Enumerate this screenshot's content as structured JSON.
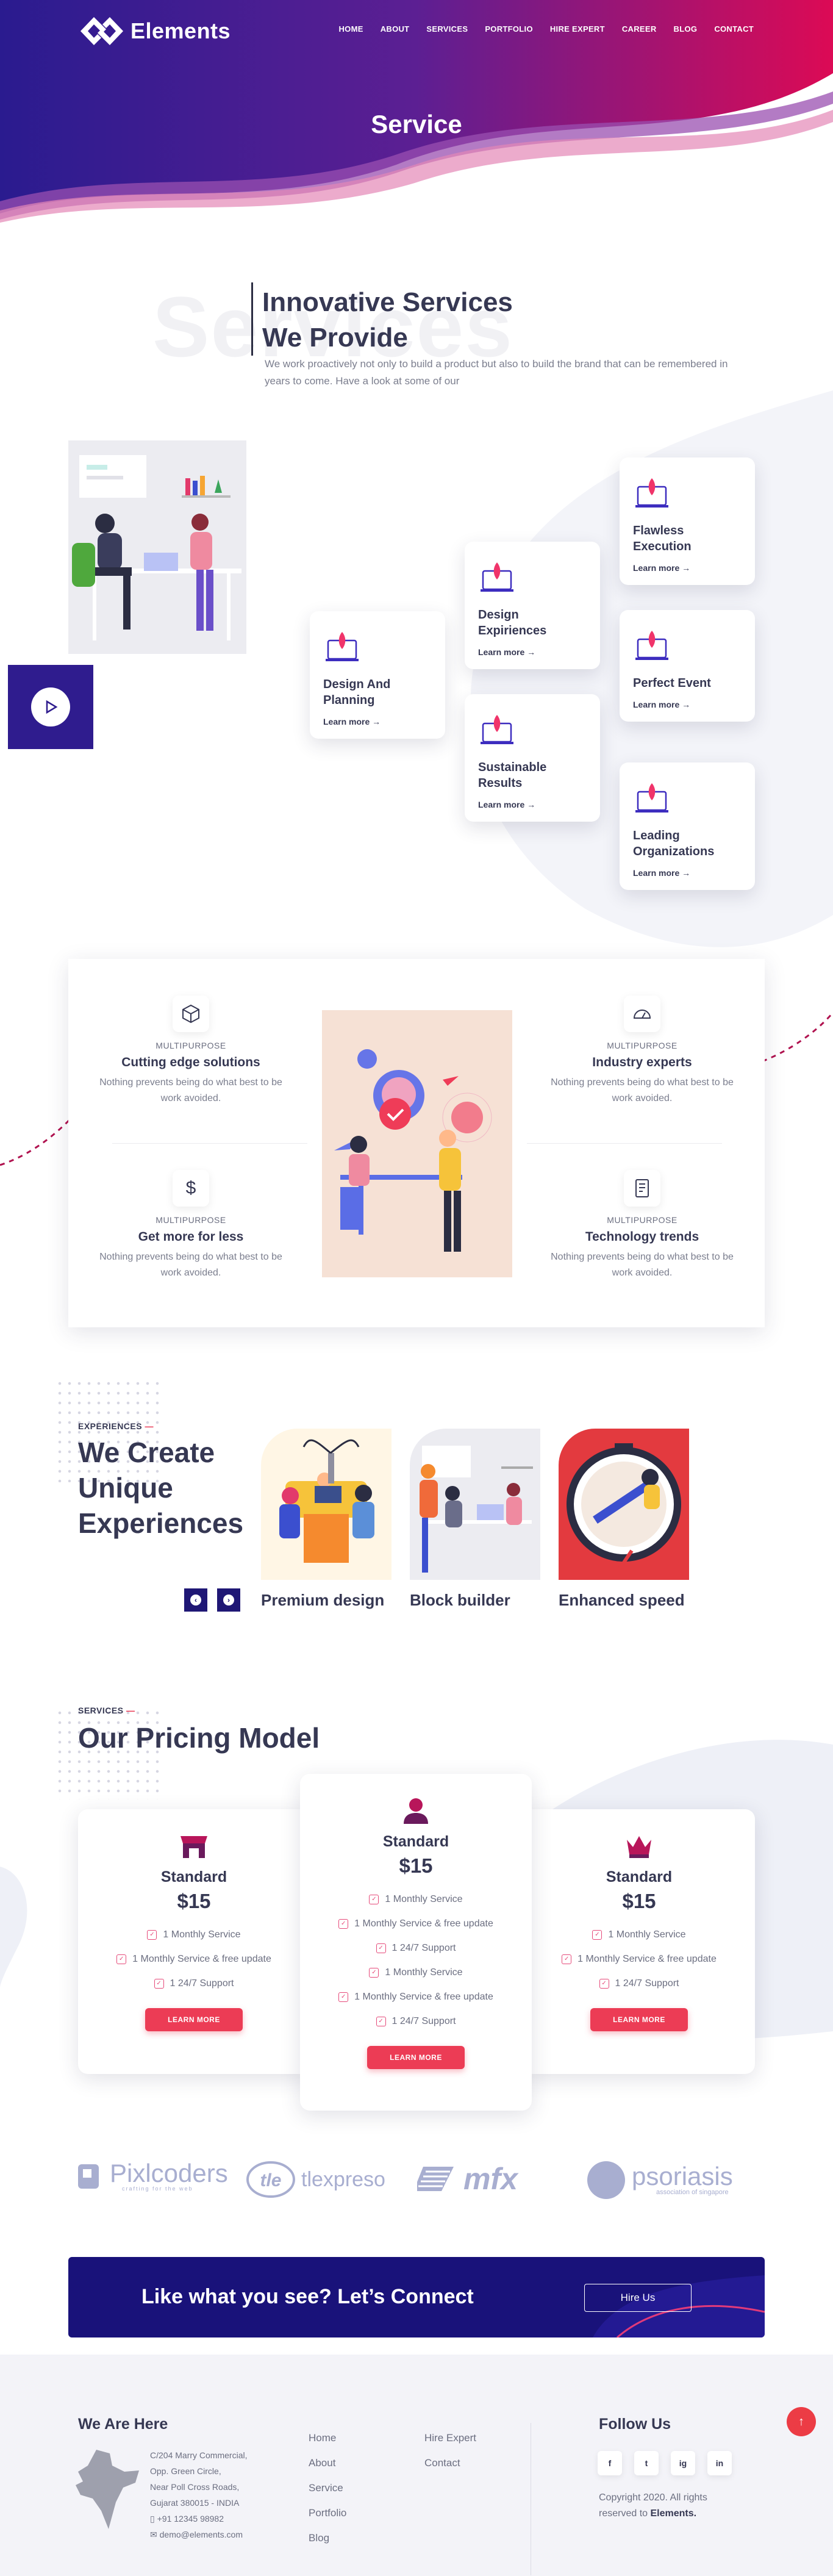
{
  "brand": {
    "name": "Elements"
  },
  "nav": [
    "HOME",
    "ABOUT",
    "SERVICES",
    "PORTFOLIO",
    "HIRE EXPERT",
    "CAREER",
    "BLOG",
    "CONTACT"
  ],
  "hero": {
    "title": "Service"
  },
  "intro": {
    "ghost": "Services",
    "title_line1": "Innovative Services",
    "title_line2": "We Provide",
    "text": "We work proactively not only to build a product but also to build the brand that can be remembered in years to come. Have a look at some of our"
  },
  "services": {
    "learn_more": "Learn more →",
    "items": [
      "Design And Planning",
      "Design Expiriences",
      "Sustainable Results",
      "Flawless Execution",
      "Perfect Event",
      "Leading Organizations"
    ]
  },
  "features": {
    "items": [
      {
        "tag": "MULTIPURPOSE",
        "title": "Cutting edge solutions",
        "text": "Nothing prevents being do what best to be work avoided.",
        "icon": "cube-icon"
      },
      {
        "tag": "MULTIPURPOSE",
        "title": "Industry experts",
        "text": "Nothing prevents being do what best to be work avoided.",
        "icon": "gauge-icon"
      },
      {
        "tag": "MULTIPURPOSE",
        "title": "Get more for less",
        "text": "Nothing prevents being do what best to be work avoided.",
        "icon": "dollar-icon"
      },
      {
        "tag": "MULTIPURPOSE",
        "title": "Technology trends",
        "text": "Nothing prevents being do what best to be work avoided.",
        "icon": "notebook-icon"
      }
    ]
  },
  "experiences": {
    "tag": "EXPERIENCES",
    "title": "We Create Unique Experiences",
    "cards": [
      "Premium design",
      "Block builder",
      "Enhanced speed"
    ],
    "prev": "‹",
    "next": "›"
  },
  "pricing": {
    "tag": "SERVICES",
    "title": "Our Pricing Model",
    "plans": [
      {
        "name": "Standard",
        "price": "$15",
        "icon": "store-icon",
        "features": [
          "1 Monthly Service",
          "1 Monthly Service & free update",
          "1 24/7 Support"
        ],
        "button": "LEARN MORE"
      },
      {
        "name": "Standard",
        "price": "$15",
        "icon": "user-icon",
        "features": [
          "1 Monthly Service",
          "1 Monthly Service & free update",
          "1 24/7 Support",
          "1 Monthly Service",
          "1 Monthly Service & free update",
          "1 24/7 Support"
        ],
        "button": "LEARN MORE"
      },
      {
        "name": "Standard",
        "price": "$15",
        "icon": "crown-icon",
        "features": [
          "1 Monthly Service",
          "1 Monthly Service & free update",
          "1 24/7 Support"
        ],
        "button": "LEARN MORE"
      }
    ]
  },
  "clients": [
    "Pixlcoders",
    "tlexpreso",
    "mfx",
    "psoriasis"
  ],
  "client_subs": {
    "pixlcoders": "crafting for the web",
    "psoriasis": "association of singapore"
  },
  "cta": {
    "title": "Like what you see? Let’s Connect",
    "button": "Hire Us"
  },
  "footer": {
    "here_title": "We Are Here",
    "address": [
      "C/204 Marry Commercial,",
      "Opp. Green Circle,",
      "Near Poll Cross Roads,",
      "Gujarat 380015 - INDIA"
    ],
    "phone": "+91 12345 98982",
    "email": "demo@elements.com",
    "links_col1": [
      "Home",
      "About",
      "Service",
      "Portfolio",
      "Blog"
    ],
    "links_col2": [
      "Hire Expert",
      "Contact"
    ],
    "follow_title": "Follow Us",
    "social": [
      "f",
      "t",
      "ig",
      "in"
    ],
    "copyright": "Copyright 2020. All rights reserved to",
    "copyright_brand": "Elements."
  },
  "colors": {
    "navy": "#1f1775",
    "accent_red": "#ec3c55",
    "pink": "#d7155e",
    "text_dark": "#363853"
  }
}
